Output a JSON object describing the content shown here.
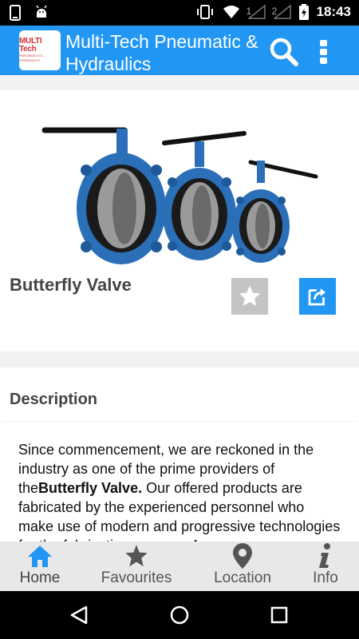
{
  "status_bar": {
    "time": "18:43",
    "sim1": "1",
    "sim2": "2"
  },
  "app_bar": {
    "logo_line1": "MULTI Tech",
    "logo_line2": "PNEUMATICS & HYDRAULICS",
    "title": "Multi-Tech Pneumatic & Hydraulics",
    "search_icon": "search-icon",
    "menu_icon": "overflow-menu-icon"
  },
  "product": {
    "name": "Butterfly Valve",
    "image_alt": "three blue butterfly valves with levers"
  },
  "description": {
    "title": "Description",
    "text_before": "Since commencement, we are reckoned in the industry as one of the prime providers of the",
    "highlight": "Butterfly Valve.",
    "text_after": " Our offered products are fabricated by the experienced personnel who make use of modern and progressive technologies for the fabrication process. A"
  },
  "bottom_nav": {
    "items": [
      {
        "label": "Home",
        "icon": "home-icon",
        "active": true
      },
      {
        "label": "Favourites",
        "icon": "star-icon",
        "active": false
      },
      {
        "label": "Location",
        "icon": "location-pin-icon",
        "active": false
      },
      {
        "label": "Info",
        "icon": "info-icon",
        "active": false
      }
    ]
  },
  "colors": {
    "primary": "#2196f3",
    "fav_button": "#c4c4c4",
    "active_nav": "#2196f3",
    "inactive_nav": "#555555"
  }
}
